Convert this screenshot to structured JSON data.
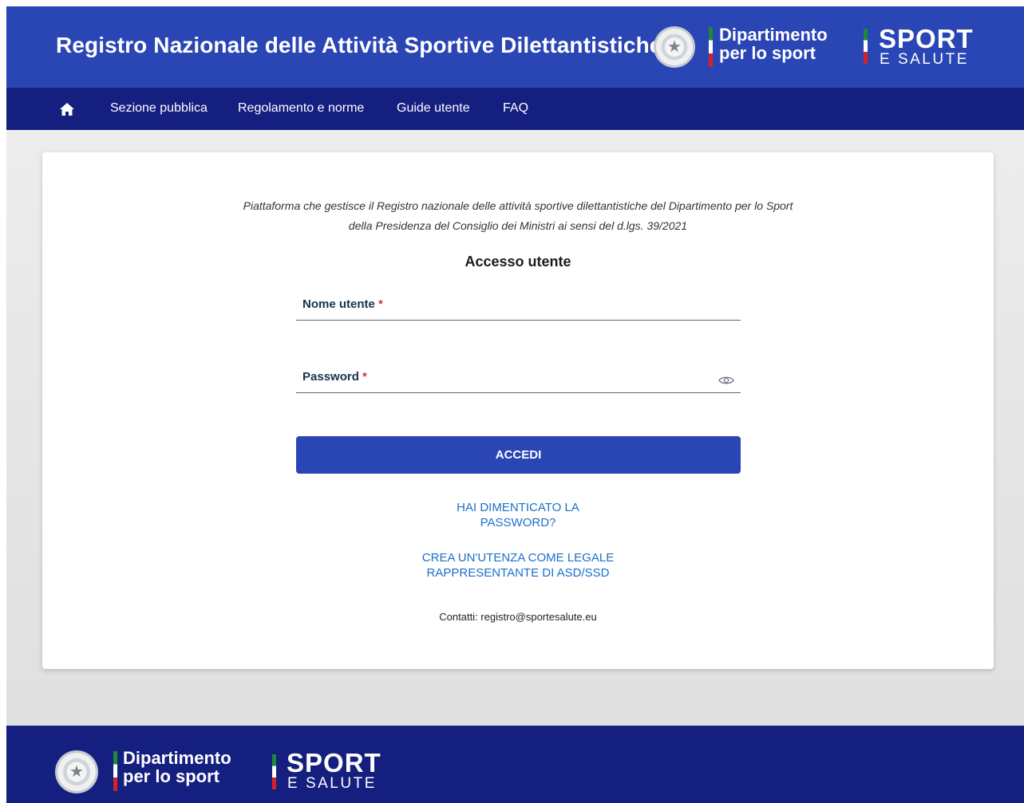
{
  "header": {
    "title": "Registro Nazionale delle Attività Sportive Dilettantistiche",
    "dipartimento_line1": "Dipartimento",
    "dipartimento_line2": "per lo sport",
    "sport_word": "SPORT",
    "salute_word": "E SALUTE",
    "emblem_icon": "repubblica-italiana-emblem-icon"
  },
  "nav": {
    "home_icon": "home-icon",
    "items": [
      {
        "label": "Sezione pubblica"
      },
      {
        "label": "Regolamento e norme"
      },
      {
        "label": "Guide utente"
      },
      {
        "label": "FAQ"
      }
    ]
  },
  "main": {
    "intro_line1": "Piattaforma che gestisce il Registro nazionale delle attività sportive dilettantistiche del Dipartimento per lo Sport",
    "intro_line2": "della Presidenza del Consiglio dei Ministri ai sensi del d.lgs. 39/2021",
    "login_title": "Accesso utente",
    "username": {
      "label": "Nome utente",
      "required_mark": "*",
      "value": ""
    },
    "password": {
      "label": "Password",
      "required_mark": "*",
      "value": "",
      "toggle_icon": "eye-icon"
    },
    "submit_label": "ACCEDI",
    "forgot_line1": "HAI DIMENTICATO LA",
    "forgot_line2": "PASSWORD?",
    "create_line1": "CREA UN'UTENZA COME LEGALE",
    "create_line2": "RAPPRESENTANTE DI ASD/SSD",
    "contacts": "Contatti: registro@sportesalute.eu"
  },
  "footer": {
    "dipartimento_line1": "Dipartimento",
    "dipartimento_line2": "per lo sport",
    "sport_word": "SPORT",
    "salute_word": "E SALUTE"
  },
  "colors": {
    "header_blue": "#2a45b4",
    "nav_blue": "#141f80",
    "link_blue": "#1c6fc9",
    "required_red": "#d1344c"
  }
}
